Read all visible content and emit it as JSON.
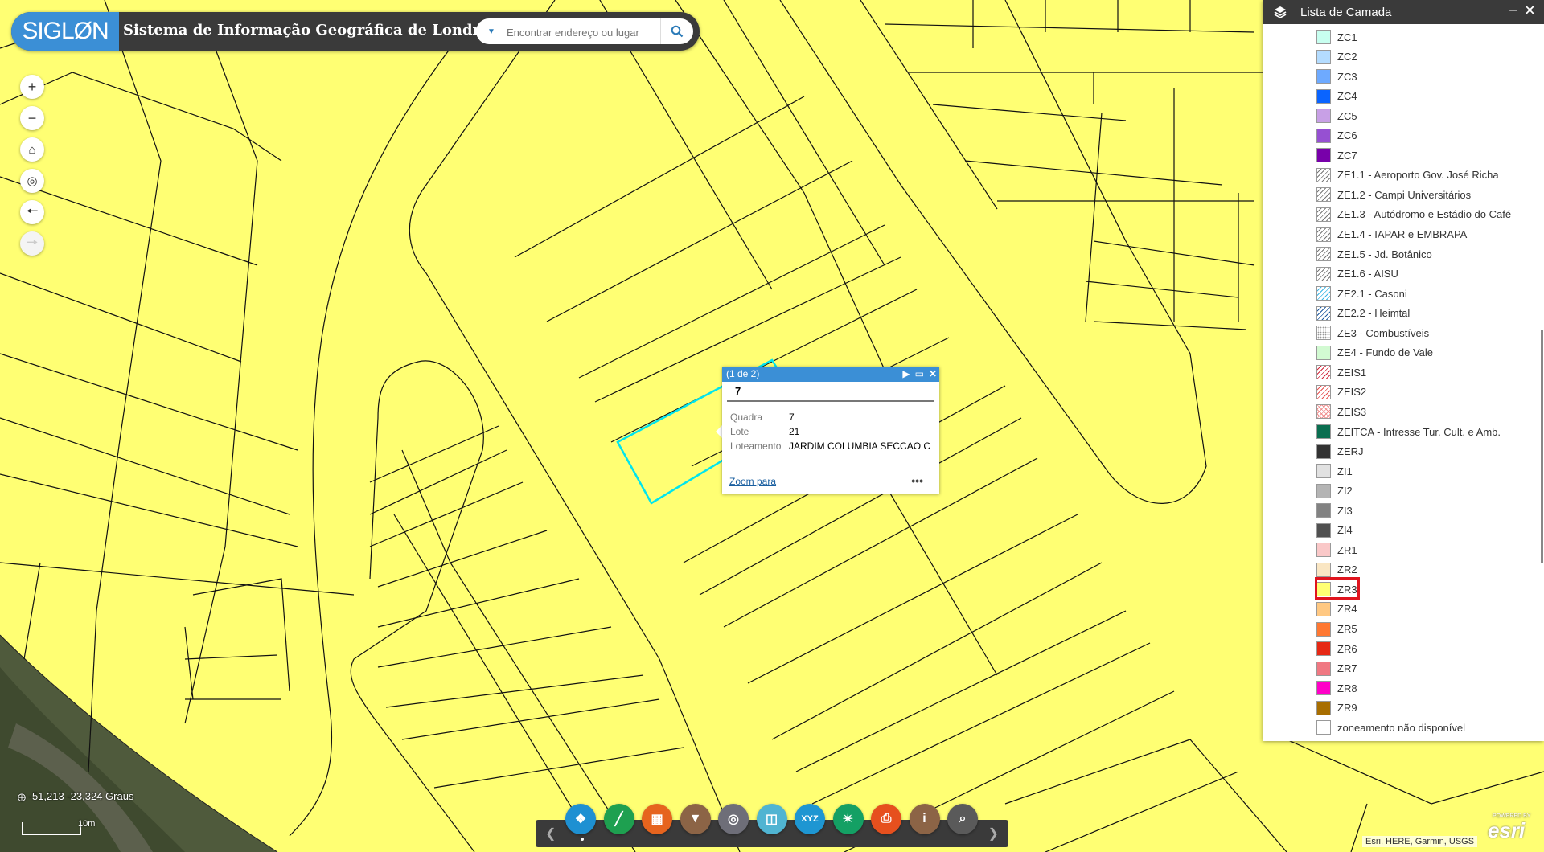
{
  "app": {
    "logo_text": "SIGLØN",
    "title": "Sistema de Informação Geográfica de Londrina",
    "search_placeholder": "Encontrar endereço ou lugar"
  },
  "map_tools": [
    "zoom-in-icon",
    "zoom-out-icon",
    "home-icon",
    "locate-icon",
    "back-icon",
    "forward-icon"
  ],
  "popup": {
    "header": "(1 de 2)",
    "title": "7",
    "fields": [
      {
        "key": "Quadra",
        "value": "7"
      },
      {
        "key": "Lote",
        "value": "21"
      },
      {
        "key": "Loteamento",
        "value": "JARDIM COLUMBIA SECCAO C"
      }
    ],
    "zoom_label": "Zoom para",
    "more_label": "•••"
  },
  "layer_panel": {
    "title": "Lista de Camada",
    "items": [
      {
        "label": "ZC1",
        "color": "#c8fff0",
        "pattern": "solid"
      },
      {
        "label": "ZC2",
        "color": "#b4dcff",
        "pattern": "solid"
      },
      {
        "label": "ZC3",
        "color": "#6eaaff",
        "pattern": "solid"
      },
      {
        "label": "ZC4",
        "color": "#0a64ff",
        "pattern": "solid"
      },
      {
        "label": "ZC5",
        "color": "#c8a0e6",
        "pattern": "solid"
      },
      {
        "label": "ZC6",
        "color": "#9650d2",
        "pattern": "solid"
      },
      {
        "label": "ZC7",
        "color": "#7800aa",
        "pattern": "solid"
      },
      {
        "label": "ZE1.1 - Aeroporto Gov. José Richa",
        "color": "#777777",
        "pattern": "hatch"
      },
      {
        "label": "ZE1.2 - Campi Universitários",
        "color": "#777777",
        "pattern": "hatch"
      },
      {
        "label": "ZE1.3 - Autódromo e Estádio do Café",
        "color": "#777777",
        "pattern": "hatch"
      },
      {
        "label": "ZE1.4 - IAPAR e EMBRAPA",
        "color": "#777777",
        "pattern": "hatch"
      },
      {
        "label": "ZE1.5 - Jd. Botânico",
        "color": "#777777",
        "pattern": "hatch"
      },
      {
        "label": "ZE1.6 - AISU",
        "color": "#777777",
        "pattern": "hatch"
      },
      {
        "label": "ZE2.1 - Casoni",
        "color": "#3ab4e6",
        "pattern": "hatch"
      },
      {
        "label": "ZE2.2 - Heimtal",
        "color": "#1e5aa0",
        "pattern": "hatch"
      },
      {
        "label": "ZE3 - Combustíveis",
        "color": "#999999",
        "pattern": "dots"
      },
      {
        "label": "ZE4 - Fundo de Vale",
        "color": "#d2fad2",
        "pattern": "solid"
      },
      {
        "label": "ZEIS1",
        "color": "#d2283c",
        "pattern": "hatch"
      },
      {
        "label": "ZEIS2",
        "color": "#e65050",
        "pattern": "hatch"
      },
      {
        "label": "ZEIS3",
        "color": "#f08c8c",
        "pattern": "cross"
      },
      {
        "label": "ZEITCA - Intresse Tur. Cult. e Amb.",
        "color": "#0a6e50",
        "pattern": "solid"
      },
      {
        "label": "ZERJ",
        "color": "#323232",
        "pattern": "solid"
      },
      {
        "label": "ZI1",
        "color": "#e1e1e1",
        "pattern": "solid"
      },
      {
        "label": "ZI2",
        "color": "#b4b4b4",
        "pattern": "solid"
      },
      {
        "label": "ZI3",
        "color": "#828282",
        "pattern": "solid"
      },
      {
        "label": "ZI4",
        "color": "#505050",
        "pattern": "solid"
      },
      {
        "label": "ZR1",
        "color": "#fac8c8",
        "pattern": "solid"
      },
      {
        "label": "ZR2",
        "color": "#fae6c3",
        "pattern": "solid"
      },
      {
        "label": "ZR3",
        "color": "#ffff73",
        "pattern": "solid"
      },
      {
        "label": "ZR4",
        "color": "#ffc882",
        "pattern": "solid"
      },
      {
        "label": "ZR5",
        "color": "#ff7832",
        "pattern": "solid"
      },
      {
        "label": "ZR6",
        "color": "#e62814",
        "pattern": "solid"
      },
      {
        "label": "ZR7",
        "color": "#f07882",
        "pattern": "solid"
      },
      {
        "label": "ZR8",
        "color": "#ff00c8",
        "pattern": "solid"
      },
      {
        "label": "ZR9",
        "color": "#a86e00",
        "pattern": "solid"
      },
      {
        "label": "zoneamento não disponível",
        "color": "#ffffff",
        "pattern": "solid"
      }
    ]
  },
  "toolbar": [
    {
      "name": "layer-list-icon",
      "color": "#1e90d2",
      "glyph": "❖"
    },
    {
      "name": "measure-icon",
      "color": "#1ea050",
      "glyph": "╱"
    },
    {
      "name": "basemap-gallery-icon",
      "color": "#e6641e",
      "glyph": "▦"
    },
    {
      "name": "filter-icon",
      "color": "#8c6446",
      "glyph": "▼"
    },
    {
      "name": "geolocate-icon",
      "color": "#6e6e78",
      "glyph": "◎"
    },
    {
      "name": "swipe-icon",
      "color": "#50b4d2",
      "glyph": "◫"
    },
    {
      "name": "coordinate-xyz-icon",
      "color": "#1e96d2",
      "glyph": "XYZ"
    },
    {
      "name": "share-icon",
      "color": "#14a064",
      "glyph": "✴"
    },
    {
      "name": "print-icon",
      "color": "#e6501e",
      "glyph": "⎙"
    },
    {
      "name": "about-icon",
      "color": "#8c6446",
      "glyph": "i"
    },
    {
      "name": "query-icon",
      "color": "#5a5a5a",
      "glyph": "⌕"
    }
  ],
  "status": {
    "coordinates": "-51,213 -23,324 Graus",
    "scale_label": "10m",
    "attribution": "Esri, HERE, Garmin, USGS",
    "esri_powered": "POWERED BY",
    "esri_logo": "esri"
  },
  "colors": {
    "zone_fill": "#ffff73",
    "selection": "#00e5ee",
    "header_bg": "#3a3a3a",
    "accent": "#3b8fd6"
  }
}
